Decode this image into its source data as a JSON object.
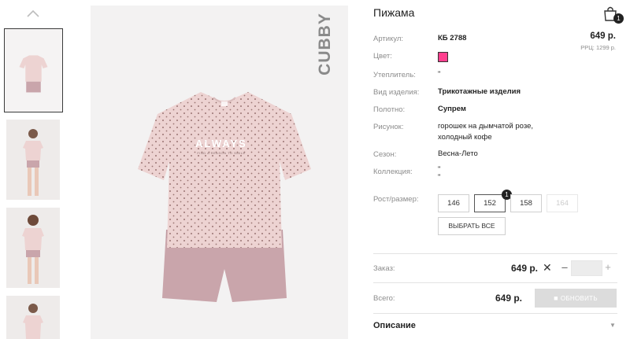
{
  "product": {
    "title": "Пижама",
    "price": "649 р.",
    "rrp": "РРЦ: 1299 р.",
    "cart_count": "1"
  },
  "details": [
    {
      "label": "Артикул:",
      "value": "КБ 2788"
    },
    {
      "label": "Цвет:",
      "value": ""
    },
    {
      "label": "Утеплитель:",
      "value": "\""
    },
    {
      "label": "Вид изделия:",
      "value": "Трикотажные изделия"
    },
    {
      "label": "Полотно:",
      "value": "Супрем"
    },
    {
      "label": "Рисунок:",
      "value": "горошек на дымчатой розе, холодный кофе"
    },
    {
      "label": "Сезон:",
      "value": "Весна-Лето"
    },
    {
      "label": "Коллекция:",
      "value": "\"\n\""
    }
  ],
  "color_swatch": "#ff3f8e",
  "sizes": {
    "label": "Рост/размер:",
    "options": [
      "146",
      "152",
      "158",
      "164"
    ],
    "selected": "152",
    "selected_count": "1",
    "disabled": [
      "164"
    ],
    "select_all_label": "ВЫБРАТЬ ВСЕ"
  },
  "order": {
    "label": "Заказ:",
    "price": "649 р.",
    "remove_symbol": "✕",
    "minus": "–",
    "plus": "+",
    "quantity": ""
  },
  "total": {
    "label": "Всего:",
    "price": "649 р.",
    "update_label": "ОБНОВИТЬ"
  },
  "description": {
    "label": "Описание"
  },
  "brand_watermark": "CUBBY",
  "shirt_print": {
    "headline": "ALWAYS",
    "subline": "FIND A REASON TO SMILE"
  },
  "colors": {
    "shirt": "#edd3d2",
    "shorts": "#c9a5ab",
    "dot": "#9a7472",
    "image_bg": "#f3f2f2"
  },
  "icons": {
    "thumbs_up_arrow": "chevron-up-icon",
    "cart": "shopping-bag-icon",
    "update": "cart-icon",
    "description_toggle": "chevron-down-icon"
  }
}
